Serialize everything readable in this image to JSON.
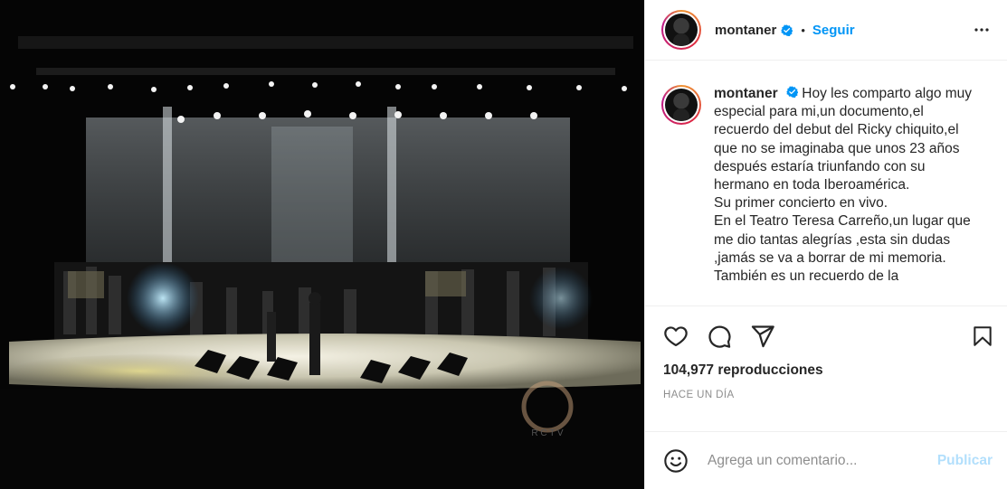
{
  "post": {
    "media": {
      "channel_logo_text": "R C T V"
    },
    "header": {
      "username": "montaner",
      "separator": "•",
      "follow_label": "Seguir"
    },
    "caption": {
      "username": "montaner",
      "lines": [
        "Hoy les comparto algo muy",
        "especial para mi,un documento,el",
        "recuerdo del debut del Ricky chiquito,el",
        "que no se imaginaba que unos 23 años",
        "después estaría triunfando con su",
        "hermano en toda Iberoamérica.",
        "Su primer concierto en vivo.",
        "En el Teatro Teresa Carreño,un lugar que",
        "me dio tantas alegrías ,esta sin dudas",
        ",jamás se va a borrar de mi memoria.",
        "También es un recuerdo de la"
      ]
    },
    "stats": {
      "views": "104,977 reproducciones",
      "time": "HACE UN DÍA"
    },
    "comment": {
      "placeholder": "Agrega un comentario...",
      "publish_label": "Publicar"
    },
    "icons": {
      "verified": "verified-badge-icon",
      "more": "more-options-icon",
      "like": "heart-icon",
      "comment": "comment-bubble-icon",
      "share": "paper-plane-icon",
      "save": "bookmark-icon",
      "emoji": "emoji-smiley-icon"
    },
    "colors": {
      "accent": "#0095f6",
      "publish_disabled": "#b2dffc",
      "muted": "#8e8e8e",
      "text": "#262626"
    }
  }
}
